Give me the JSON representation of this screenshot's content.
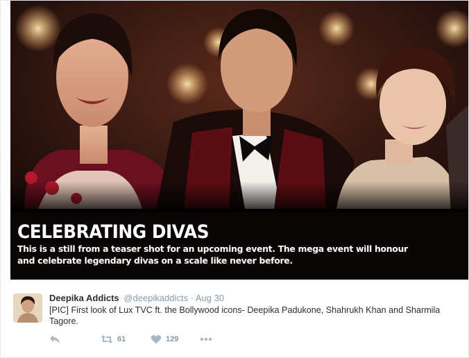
{
  "media": {
    "headline": "CELEBRATING DIVAS",
    "caption_line1": "This is a still from a teaser shot for an upcoming event. The mega event will honour",
    "caption_line2": "and celebrate legendary divas on a scale like never before."
  },
  "tweet": {
    "display_name": "Deepika Addicts",
    "handle": "@deepikaddicts",
    "separator": "·",
    "timestamp": "Aug 30",
    "text": "[PIC] First look of Lux TVC ft. the Bollywood icons- Deepika Padukone, Shahrukh Khan and Sharmila Tagore.",
    "actions": {
      "reply_icon": "reply-icon",
      "retweet_icon": "retweet-icon",
      "retweet_count": "61",
      "like_icon": "heart-icon",
      "like_count": "129",
      "more_icon": "more-icon"
    }
  },
  "colors": {
    "text_primary": "#292f33",
    "text_secondary": "#8899a6",
    "icon_gray": "#aab8c2",
    "border": "#e1e8ed"
  }
}
